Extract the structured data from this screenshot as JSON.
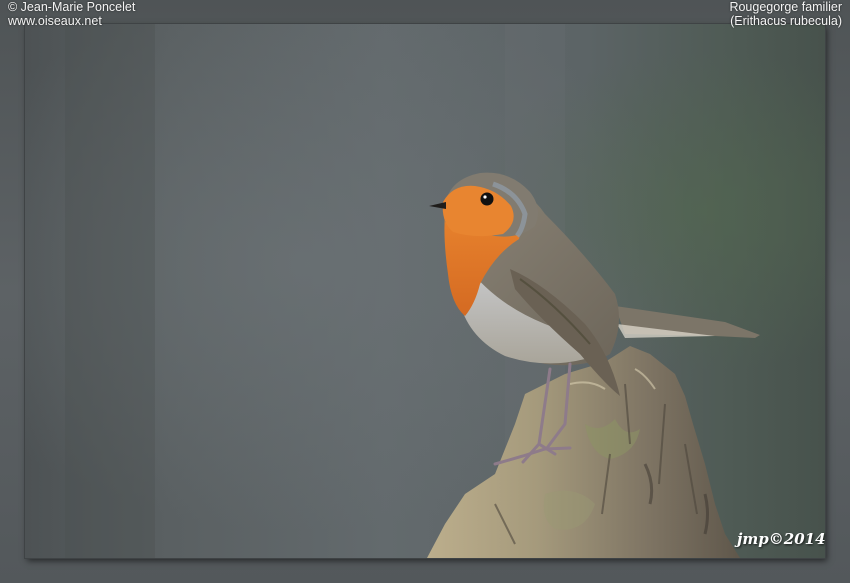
{
  "credit": {
    "copyright_line": "© Jean-Marie Poncelet",
    "website": "www.oiseaux.net"
  },
  "species": {
    "common_name": "Rougegorge familier",
    "scientific_name": "(Erithacus rubecula)"
  },
  "signature": "jmp©2014",
  "colors": {
    "background": "#5b5f62",
    "robin_breast": "#e07a2a",
    "robin_back": "#7b7466",
    "stump": "#8f8672"
  }
}
